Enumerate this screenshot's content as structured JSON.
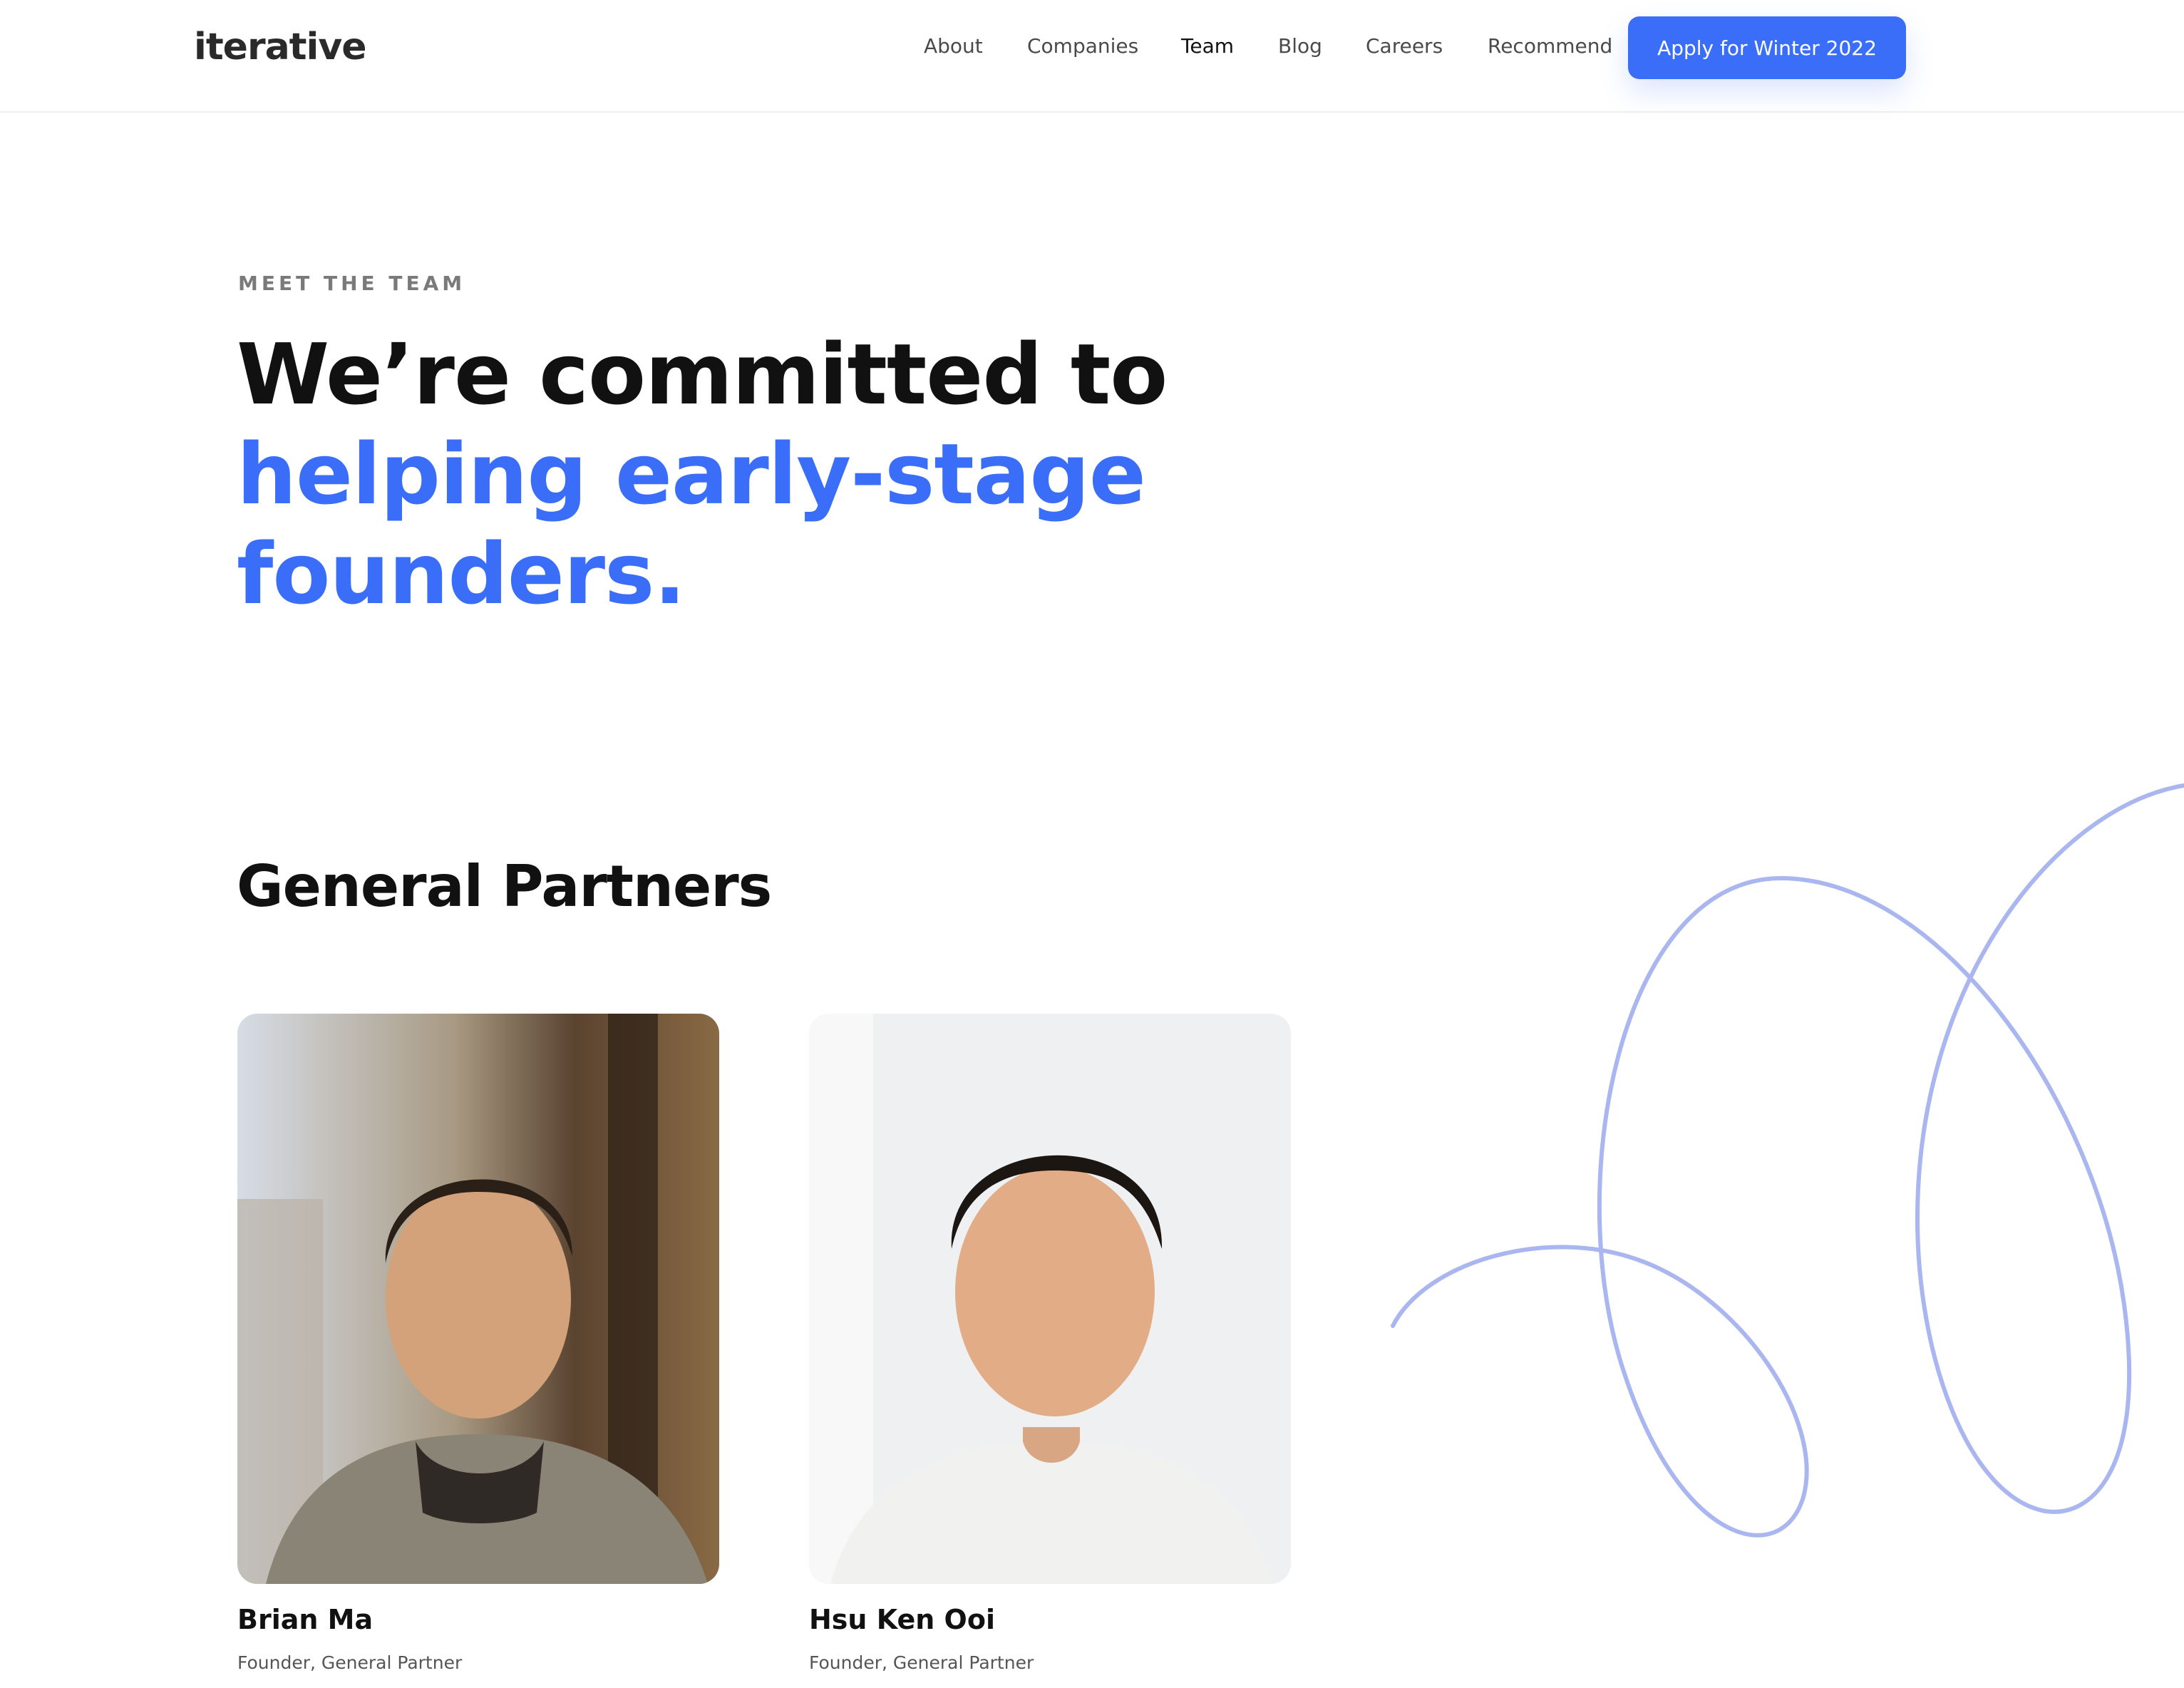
{
  "brand": {
    "logo_text": "iterative",
    "accent_color": "#3b6ef8"
  },
  "nav": {
    "items": [
      {
        "label": "About",
        "active": false
      },
      {
        "label": "Companies",
        "active": false
      },
      {
        "label": "Team",
        "active": true
      },
      {
        "label": "Blog",
        "active": false
      },
      {
        "label": "Careers",
        "active": false
      },
      {
        "label": "Recommend",
        "active": false
      }
    ],
    "cta_label": "Apply for Winter 2022"
  },
  "hero": {
    "eyebrow": "MEET THE TEAM",
    "headline_plain": "We’re committed to ",
    "headline_accent": "helping early-stage founders."
  },
  "section": {
    "title": "General Partners",
    "members": [
      {
        "name": "Brian Ma",
        "role": "Founder, General Partner"
      },
      {
        "name": "Hsu Ken Ooi",
        "role": "Founder, General Partner"
      }
    ]
  },
  "decoration": {
    "squiggle_color": "#a9b6ef"
  }
}
